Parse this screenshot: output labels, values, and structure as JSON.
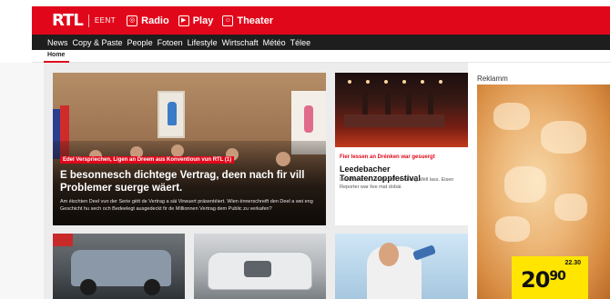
{
  "brand": {
    "logo": "RTL",
    "sub": "EENT"
  },
  "services": [
    {
      "label": "Radio",
      "icon": "radio-icon"
    },
    {
      "label": "Play",
      "icon": "play-icon"
    },
    {
      "label": "Theater",
      "icon": "theater-icon"
    }
  ],
  "nav": [
    "News",
    "Copy & Paste",
    "People",
    "Fotoen",
    "Lifestyle",
    "Wirtschaft",
    "Météo",
    "Télee"
  ],
  "breadcrumb": {
    "home": "Home"
  },
  "lead": {
    "tag": "Edel Verspriechen, Ligen an Dreem aus Konventioun vun RTL (1)",
    "title": "E besonnesch dichtege Vertrag, deen nach fir vill Problemer suerge wäert.",
    "desc": "Am éischten Deel vun der Serie gëtt de Vertrag a säi Virwuert präsentéiert. Wien ënnerschreift den Deel a wei eng Geschicht hu sech och Bedeelegt ausgedeckt fir de Millionnen Vertrag dem Public zu verkafen?"
  },
  "card2": {
    "tag": "Fier lessen an Drénken war gesuergt",
    "title": "Leedebacher Tomatenzoppfestival",
    "desc": "Ddorfit war zu Leedebach nom eng Mëll lass. Eisen Reporter war live mat dobäi."
  },
  "ad": {
    "label": "Reklamm",
    "old_price": "22.30",
    "price_main": "20",
    "price_cents": "90"
  },
  "colors": {
    "brand_red": "#e1071a",
    "nav_dark": "#1e1e1e",
    "price_yellow": "#ffe500"
  }
}
